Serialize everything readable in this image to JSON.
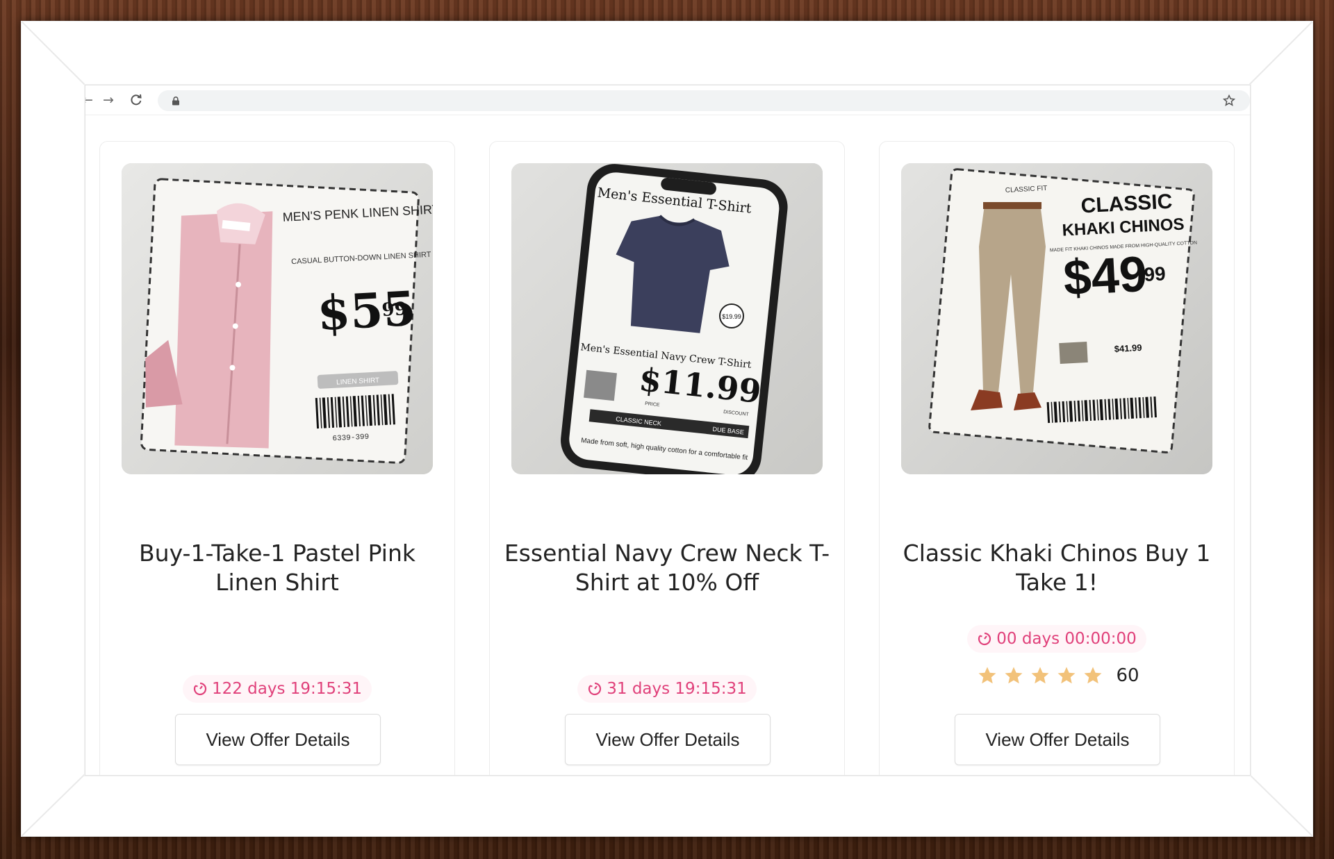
{
  "browser": {
    "back_icon": "arrow-left-icon",
    "forward_icon": "arrow-right-icon",
    "reload_icon": "reload-icon",
    "lock_icon": "lock-icon",
    "bookmark_icon": "star-outline-icon"
  },
  "offers": [
    {
      "title": "Buy-1-Take-1 Pastel Pink Linen Shirt",
      "timer": "122 days 19:15:31",
      "button": "View Offer Details",
      "image": {
        "heading": "MEN'S PENK LINEN SHIRT",
        "sub": "CASUAL BUTTON-DOWN LINEN SHIRT",
        "price": "$55",
        "cents": "99",
        "code": "6339-399",
        "tag": "LINEN SHIRT"
      }
    },
    {
      "title": "Essential Navy Crew Neck T-Shirt at 10% Off",
      "timer": "31 days 19:15:31",
      "button": "View Offer Details",
      "image": {
        "heading": "Men's Essential T-Shirt",
        "badge": "$19.99",
        "sub": "Men's Essential Navy Crew T-Shirt",
        "price": "$11.99",
        "price_label": "PRICE",
        "discount_label": "DISCOUNT",
        "strip": "CLASSIC NECK",
        "strip_right": "DUE BASE",
        "note": "Made from soft, high quality cotton for a comfortable fit"
      }
    },
    {
      "title": "Classic Khaki Chinos Buy 1 Take 1!",
      "timer": "00 days 00:00:00",
      "rating": 5,
      "rating_count": "60",
      "button": "View Offer Details",
      "image": {
        "corner": "CLASSIC FIT",
        "heading_1": "CLASSIC",
        "heading_2": "KHAKI CHINOS",
        "sub": "MADE FIT KHAKI CHINOS MADE FROM HIGH-QUALITY COTTON",
        "price": "$49",
        "cents": "99",
        "small_price": "$41.99"
      }
    }
  ],
  "colors": {
    "timer": "#e0407a",
    "star": "#f2c27a",
    "frame": "#5a2f1c"
  }
}
